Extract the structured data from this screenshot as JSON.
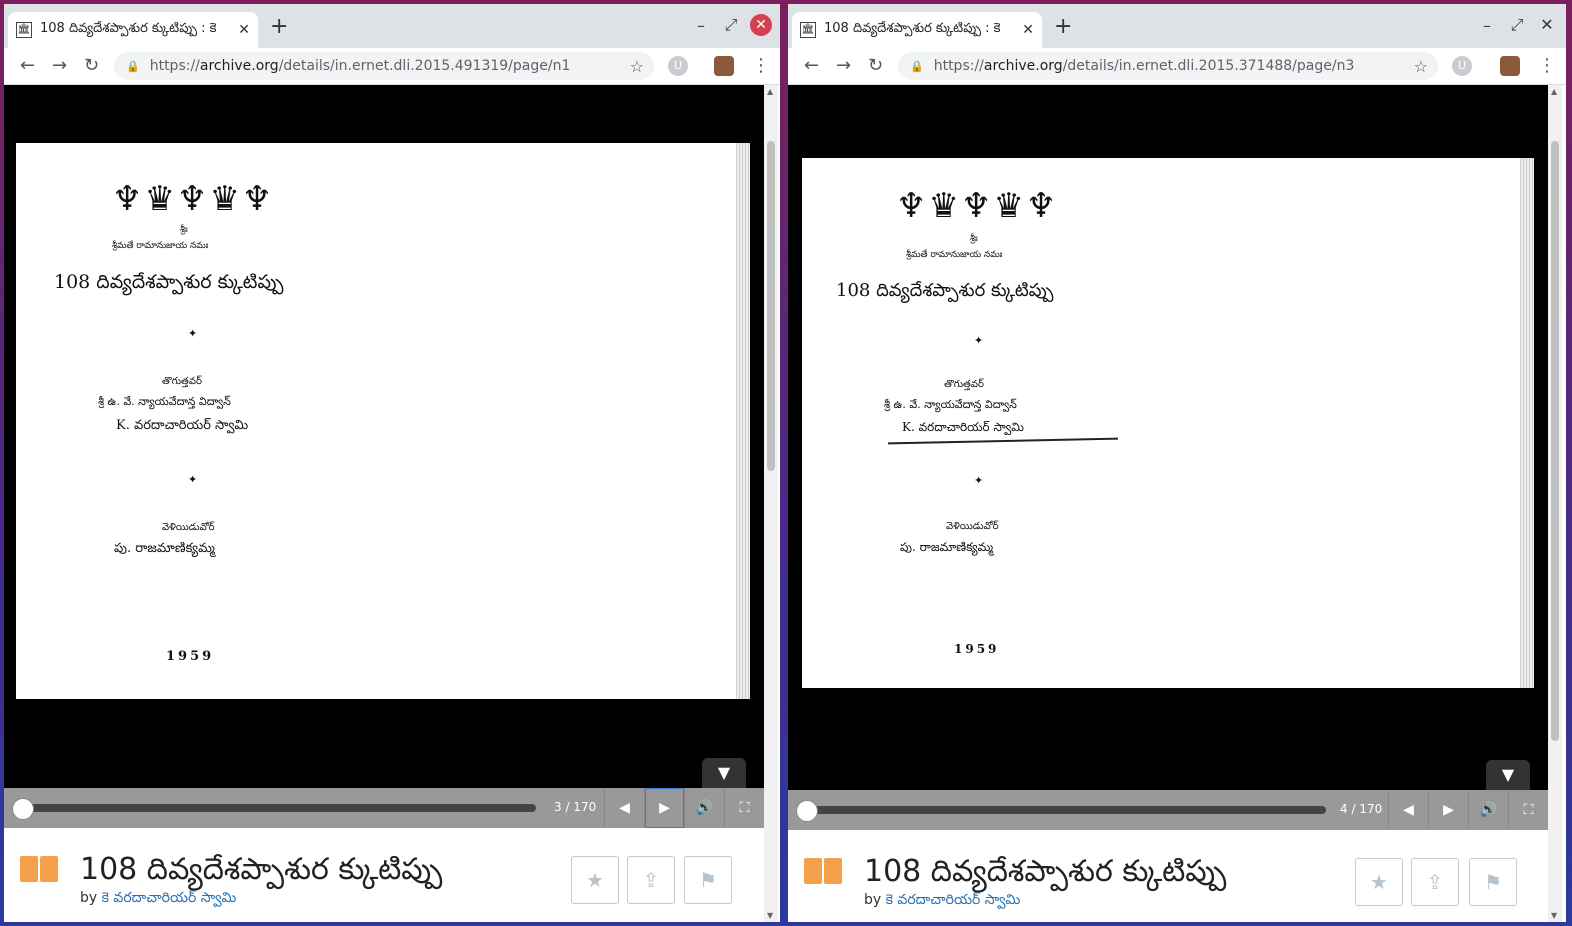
{
  "windows": [
    {
      "tab_title": "108 దివ్యదేశప్పాశుర క్కుటిప్పు : కె",
      "url_prefix": "https://",
      "url_host": "archive.org",
      "url_path": "/details/in.ernet.dli.2015.491319/page/n1",
      "page_counter": "3 / 170",
      "page": {
        "invocation": "శ్రీః",
        "salutation": "శ్రీమతే రామానుజాయ నమః",
        "book_title": "108 దివ్యదేశప్పాశుర క్కుటిప్పు",
        "divider1": "✦",
        "author_label": "తొగుత్తవర్",
        "author_line1": "శ్రీ ఉ. వే. న్యాయవేదాన్త విద్వాన్",
        "author_line2": "K. వరదాచారియర్ స్వామి",
        "divider2": "✦",
        "publisher_label": "వెళియిడువోర్",
        "publisher": "పు. రాజమాణిక్యమ్మ",
        "year": "1959"
      },
      "info_title": "108 దివ్యదేశప్పాశుర క్కుటిప్పు",
      "by_label": "by",
      "author": "కె వరదాచారియర్ స్వామి"
    },
    {
      "tab_title": "108 దివ్యదేశప్పాశుర క్కుటిప్పు : కె",
      "url_prefix": "https://",
      "url_host": "archive.org",
      "url_path": "/details/in.ernet.dli.2015.371488/page/n3",
      "page_counter": "4 / 170",
      "page": {
        "invocation": "శ్రీః",
        "salutation": "శ్రీమతే రామానుజాయ నమః",
        "book_title": "108 దివ్యదేశప్పాశుర క్కుటిప్పు",
        "divider1": "✦",
        "author_label": "తొగుత్తవర్",
        "author_line1": "శ్రీ ఉ. వే. న్యాయవేదాన్త విద్వాన్",
        "author_line2": "K. వరదాచారియర్ స్వామి",
        "divider2": "✦",
        "publisher_label": "వెళియిడువోర్",
        "publisher": "పు. రాజమాణిక్యమ్మ",
        "year": "1959"
      },
      "info_title": "108 దివ్యదేశప్పాశుర క్కుటిప్పు",
      "by_label": "by",
      "author": "కె వరదాచారియర్ స్వామి"
    }
  ],
  "icons": {
    "back": "←",
    "forward": "→",
    "reload": "↻",
    "lock": "🔒",
    "star": "☆",
    "menu": "⋮",
    "newtab": "+",
    "minimize": "–",
    "maximize": "⤢",
    "close": "✕",
    "prev": "◀",
    "next": "▶",
    "audio": "🔊",
    "fullscreen": "⛶",
    "toggle": "▼",
    "favorite": "★",
    "share": "⇪",
    "flag": "⚑",
    "ext": "U",
    "archive": "🏛"
  },
  "colors": {
    "accent": "#f5a04a",
    "link": "#2a6fb3",
    "close": "#d6404e"
  }
}
